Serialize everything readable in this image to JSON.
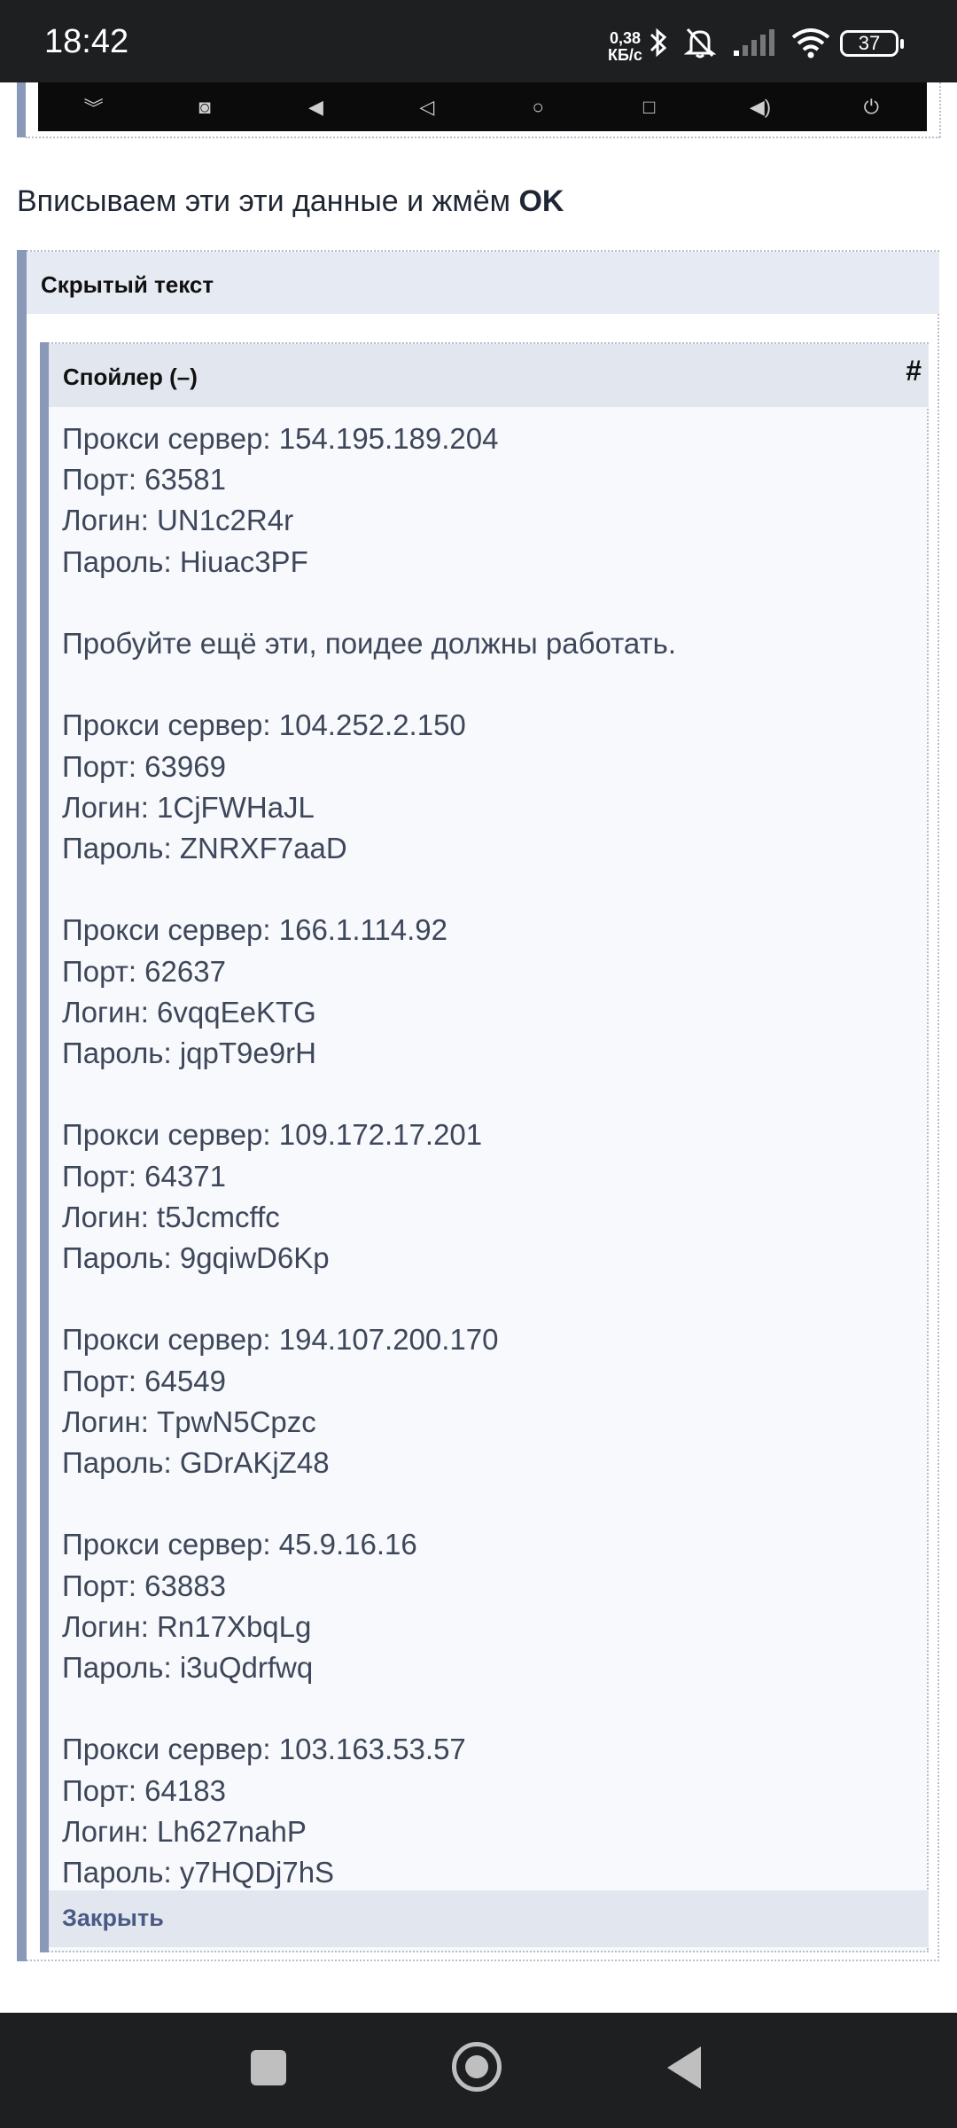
{
  "status_bar": {
    "time": "18:42",
    "net_speed_value": "0,38",
    "net_speed_unit": "КБ/с",
    "battery": "37",
    "icons": [
      "bluetooth-icon",
      "bell-off-icon",
      "signal-icon",
      "wifi-icon",
      "battery-icon"
    ]
  },
  "top_nav_strip": {
    "icons": [
      "chevron-double-down-icon",
      "screenshot-icon",
      "volume-down-icon",
      "back-triangle-icon",
      "home-circle-icon",
      "recents-square-icon",
      "volume-up-icon",
      "power-icon"
    ]
  },
  "instruction": {
    "text": "Вписываем эти эти данные и жмём ",
    "emphasis": "OK"
  },
  "hidden_block": {
    "title": "Скрытый текст"
  },
  "spoiler": {
    "title": "Спойлер (–)",
    "anchor": "#",
    "close_label": "Закрыть",
    "intro": {
      "server": "Прокси сервер: 154.195.189.204",
      "port": "Порт: 63581",
      "login": "Логин: UN1c2R4r",
      "password": "Пароль: Hiuac3PF"
    },
    "note": "Пробуйте ещё эти, поидее должны работать.",
    "proxies": [
      {
        "server": "Прокси сервер: 104.252.2.150",
        "port": "Порт: 63969",
        "login": "Логин: 1CjFWHaJL",
        "password": "Пароль: ZNRXF7aaD"
      },
      {
        "server": "Прокси сервер: 166.1.114.92",
        "port": "Порт: 62637",
        "login": "Логин: 6vqqEeKTG",
        "password": "Пароль: jqpT9e9rH"
      },
      {
        "server": "Прокси сервер: 109.172.17.201",
        "port": "Порт: 64371",
        "login": "Логин: t5Jcmcffc",
        "password": "Пароль: 9gqiwD6Kp"
      },
      {
        "server": "Прокси сервер: 194.107.200.170",
        "port": "Порт: 64549",
        "login": "Логин: TpwN5Cpzc",
        "password": "Пароль: GDrAKjZ48"
      },
      {
        "server": "Прокси сервер: 45.9.16.16",
        "port": "Порт: 63883",
        "login": "Логин: Rn17XbqLg",
        "password": "Пароль: i3uQdrfwq"
      },
      {
        "server": "Прокси сервер: 103.163.53.57",
        "port": "Порт: 64183",
        "login": "Логин: Lh627nahP",
        "password": "Пароль: y7HQDj7hS"
      }
    ]
  },
  "system_nav": {
    "icons": [
      "recents-icon",
      "home-icon",
      "back-icon"
    ]
  }
}
